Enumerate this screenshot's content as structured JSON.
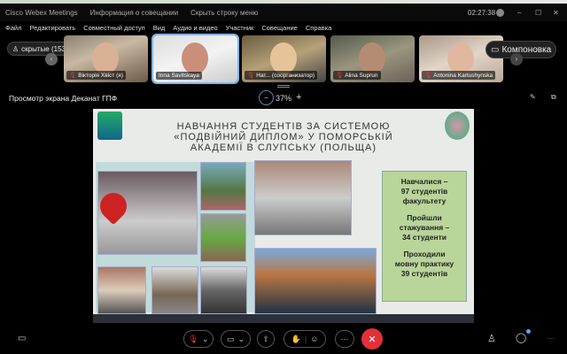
{
  "titlebar": {
    "app": "Cisco Webex Meetings",
    "info": "Информация о совещании",
    "hide_menu": "Скрыть строку меню",
    "time": "02:27:38"
  },
  "menu": [
    "Файл",
    "Редактировать",
    "Совместный доступ",
    "Вид",
    "Аудио и видео",
    "Участник",
    "Совещание",
    "Справка"
  ],
  "hidden_label": "скрытые (153)",
  "layout_label": "Компоновка",
  "participants": [
    {
      "name": "Вікторія Хвіст (я)",
      "muted": true
    },
    {
      "name": "Inna Savitskaya",
      "muted": false,
      "active": true
    },
    {
      "name": "Нат... (соорганизатор)",
      "muted": true
    },
    {
      "name": "Alina Suprun",
      "muted": true
    },
    {
      "name": "Antonina Kartushynska",
      "muted": true
    }
  ],
  "share": {
    "title": "Просмотр экрана Деканат ГПФ",
    "zoom": "37%"
  },
  "slide": {
    "title_lines": [
      "НАВЧАННЯ СТУДЕНТІВ ЗА СИСТЕМОЮ",
      "«ПОДВІЙНИЙ ДИПЛОМ» У ПОМОРСЬКІЙ",
      "АКАДЕМІЇ В СЛУПСЬКУ (ПОЛЬЩА)"
    ],
    "facts": [
      [
        "Навчалися –",
        "97 студентів",
        "факультету"
      ],
      [
        "Пройшли",
        "стажування –",
        "34 студенти"
      ],
      [
        "Проходили",
        "мовну практику",
        "39 студентів"
      ]
    ]
  },
  "colors": {
    "accent": "#7fb6ef",
    "leave": "#e0313b",
    "muted": "#e33"
  }
}
